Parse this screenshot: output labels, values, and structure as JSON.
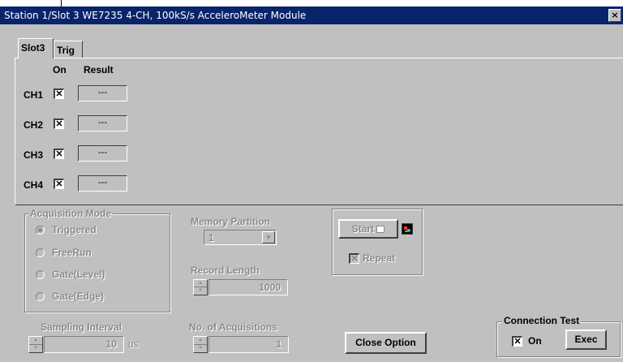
{
  "window": {
    "title": "Station 1/Slot 3 WE7235 4-CH, 100kS/s AcceleroMeter Module",
    "close_glyph": "×"
  },
  "tabs": [
    {
      "label": "Slot3"
    },
    {
      "label": "Trig"
    }
  ],
  "channels_table": {
    "headers": {
      "on": "On",
      "result": "Result"
    },
    "rows": [
      {
        "label": "CH1",
        "checked": true,
        "check_glyph": "✕",
        "result": "---"
      },
      {
        "label": "CH2",
        "checked": true,
        "check_glyph": "✕",
        "result": "---"
      },
      {
        "label": "CH3",
        "checked": true,
        "check_glyph": "✕",
        "result": "---"
      },
      {
        "label": "CH4",
        "checked": true,
        "check_glyph": "✕",
        "result": "---"
      }
    ]
  },
  "acquisition_mode": {
    "title": "Acquisition Mode",
    "options": [
      {
        "label": "Triggered",
        "selected": true
      },
      {
        "label": "FreeRun",
        "selected": false
      },
      {
        "label": "Gate(Level)",
        "selected": false
      },
      {
        "label": "Gate(Edge)",
        "selected": false
      }
    ]
  },
  "memory_partition": {
    "label": "Memory Partition",
    "value": "1",
    "arrow": "▼"
  },
  "record_length": {
    "label": "Record Length",
    "value": "1000"
  },
  "sampling_interval": {
    "label": "Sampling Interval",
    "value": "10",
    "unit": "us"
  },
  "no_of_acquisitions": {
    "label": "No. of Acquisitions",
    "value": "1"
  },
  "start_panel": {
    "start_label": "Start",
    "repeat_label": "Repeat",
    "repeat_glyph": "✕"
  },
  "close_option": {
    "label": "Close Option"
  },
  "connection_test": {
    "title": "Connection Test",
    "on_label": "On",
    "on_glyph": "✕",
    "exec_label": "Exec"
  },
  "colors": {
    "titlebar": "#08246b",
    "face": "#c0c0c0",
    "disabled_text": "#8a8a8a"
  }
}
